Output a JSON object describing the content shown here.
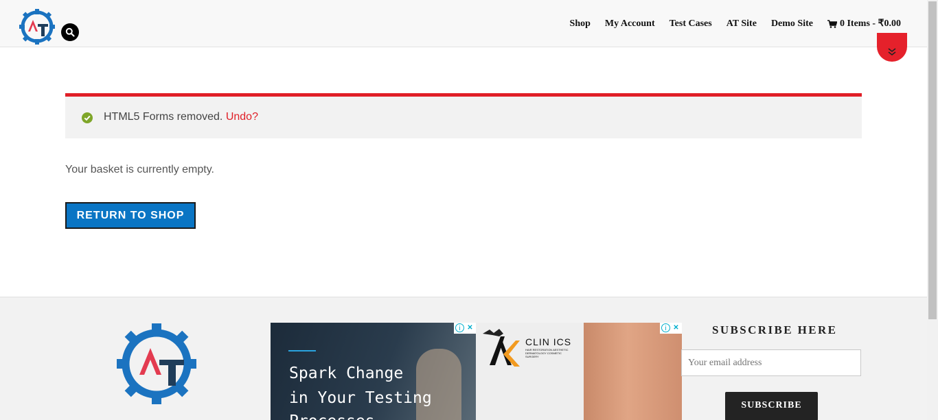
{
  "header": {
    "nav": [
      {
        "label": "Shop"
      },
      {
        "label": "My Account"
      },
      {
        "label": "Test Cases"
      },
      {
        "label": "AT Site"
      },
      {
        "label": "Demo Site"
      }
    ],
    "cart_label": "0 Items - ₹0.00"
  },
  "notice": {
    "message": "HTML5 Forms removed.",
    "undo_label": "Undo?"
  },
  "main": {
    "empty_message": "Your basket is currently empty.",
    "return_button": "RETURN TO SHOP"
  },
  "ads": {
    "ad1_lines": [
      "Spark Change",
      "in Your Testing",
      "Processes"
    ],
    "ad2_brand": "CLIN ICS",
    "ad2_sub": "HAIR RESTORATION AESTHETIC DERMATOLOGY COSMETIC SURGERY"
  },
  "footer": {
    "subscribe_title": "SUBSCRIBE HERE",
    "email_placeholder": "Your email address",
    "subscribe_button": "SUBSCRIBE"
  },
  "colors": {
    "accent_red": "#e01f27",
    "button_blue": "#0a75c4",
    "logo_blue": "#1b73c0",
    "logo_red": "#e33b50",
    "logo_dark": "#1f3d5a"
  }
}
